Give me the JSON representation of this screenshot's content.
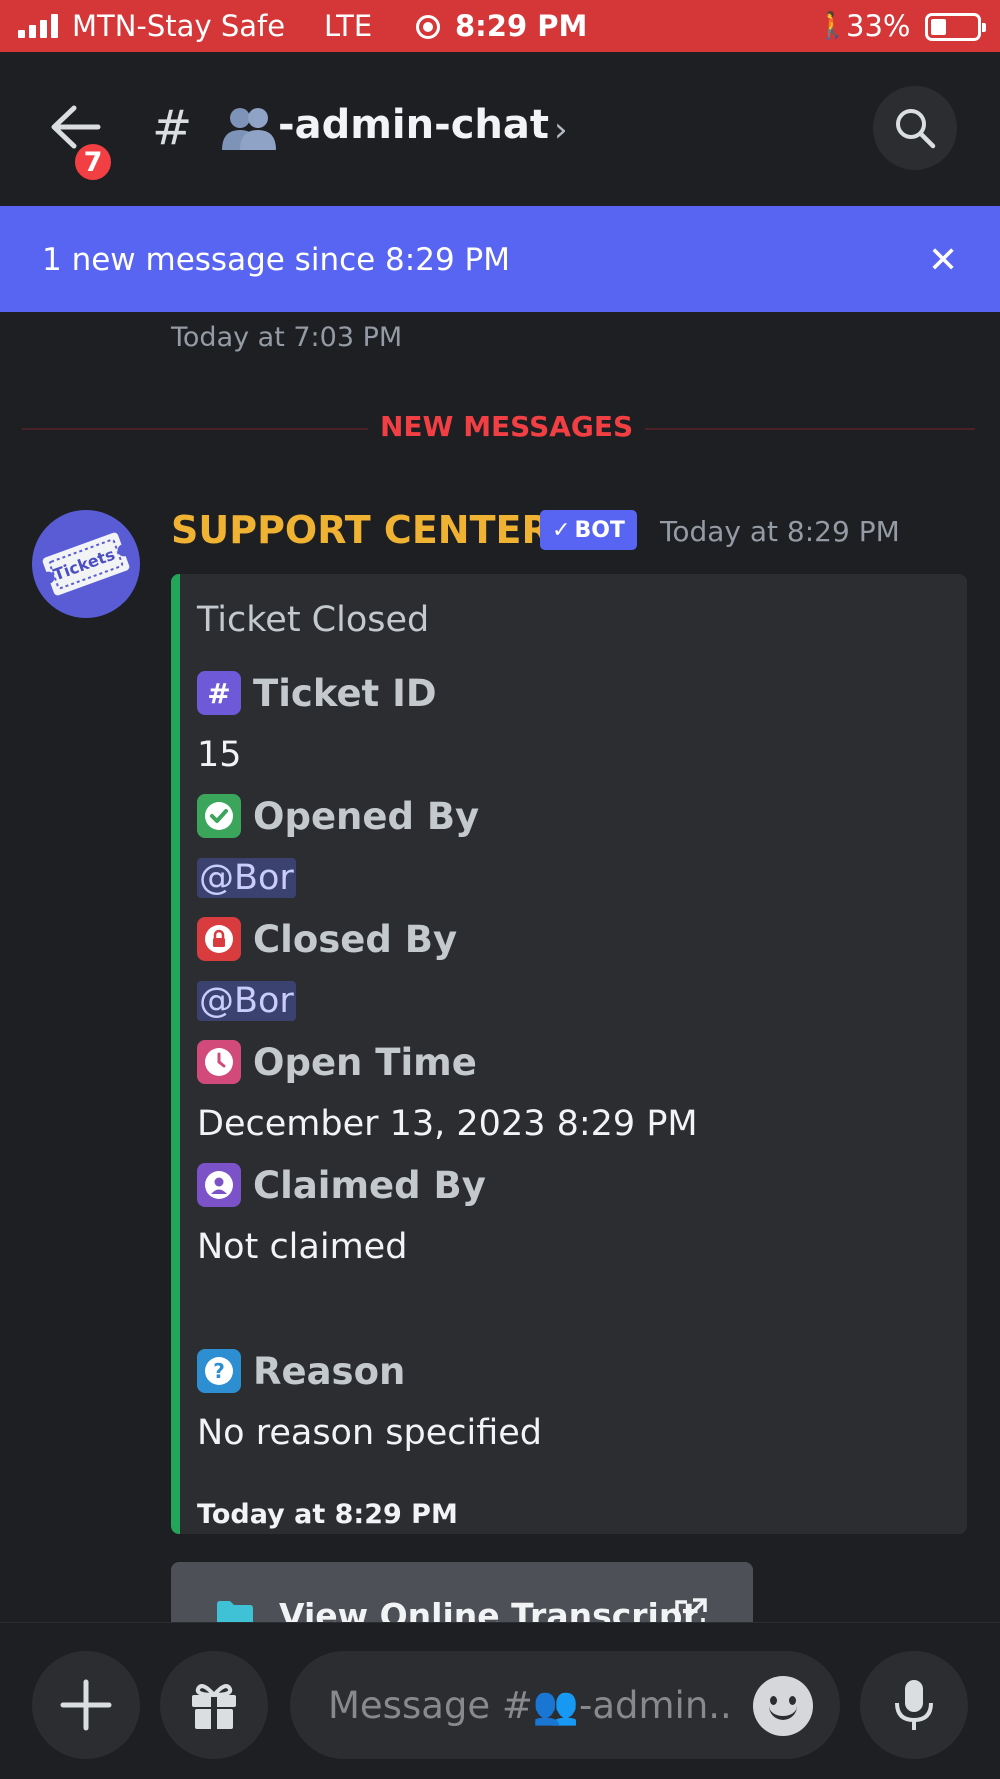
{
  "status_bar": {
    "carrier": "MTN-Stay Safe",
    "network": "LTE",
    "time": "8:29 PM",
    "battery": "33%"
  },
  "header": {
    "badge_count": "7",
    "hash": "#",
    "channel_name": "-admin-chat",
    "chevron": "›"
  },
  "banner": {
    "text": "1 new message since 8:29 PM",
    "close": "✕"
  },
  "messages": {
    "previous_timestamp": "Today at 7:03 PM",
    "divider_label": "NEW MESSAGES",
    "author": "SUPPORT CENTER",
    "bot_tag": "BOT",
    "bot_check": "✓",
    "timestamp": "Today at 8:29 PM",
    "avatar_text": "Tickets",
    "embed": {
      "title": "Ticket Closed",
      "fields": [
        {
          "name": "Ticket ID",
          "value": "15",
          "emoji": "#"
        },
        {
          "name": "Opened By",
          "value": "@Bor",
          "emoji": "✓"
        },
        {
          "name": "Closed By",
          "value": "@Bor",
          "emoji": "lock"
        },
        {
          "name": "Open Time",
          "value": "December 13, 2023 8:29 PM",
          "emoji": "clock"
        },
        {
          "name": "Claimed By",
          "value": "Not claimed",
          "emoji": "person"
        },
        {
          "name": "Reason",
          "value": "No reason specified",
          "emoji": "?"
        }
      ],
      "footer": "Today at 8:29 PM"
    },
    "link_button": "View Online Transcript"
  },
  "composer": {
    "placeholder": "Message #👥-admin..."
  },
  "colors": {
    "blurple": "#5865f2",
    "status_red": "#d53738",
    "embed_green": "#23a55a",
    "author_gold": "#f0b232",
    "alert_red": "#f23f43"
  }
}
